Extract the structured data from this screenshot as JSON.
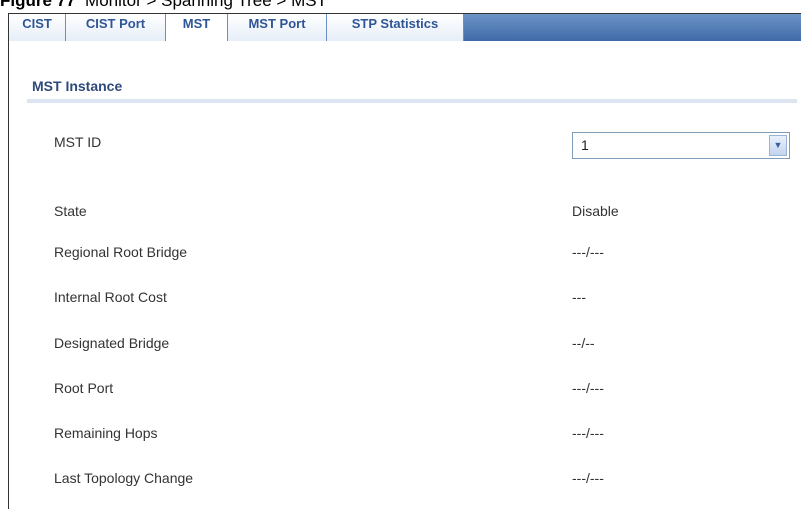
{
  "caption": {
    "figure": "Figure 77",
    "text": "Monitor > Spanning Tree > MST"
  },
  "tabs": [
    {
      "label": "CIST"
    },
    {
      "label": "CIST Port"
    },
    {
      "label": "MST"
    },
    {
      "label": "MST Port"
    },
    {
      "label": "STP Statistics"
    }
  ],
  "active_tab": "MST",
  "section": {
    "title": "MST Instance"
  },
  "mst_id": {
    "label": "MST ID",
    "value": "1"
  },
  "rows": [
    {
      "label": "State",
      "value": "Disable"
    },
    {
      "label": "Regional Root Bridge",
      "value": "---/---"
    },
    {
      "label": "Internal Root Cost",
      "value": "---"
    },
    {
      "label": "Designated Bridge",
      "value": "--/--"
    },
    {
      "label": "Root Port",
      "value": "---/---"
    },
    {
      "label": "Remaining Hops",
      "value": "---/---"
    },
    {
      "label": "Last Topology Change",
      "value": "---/---"
    }
  ],
  "colors": {
    "tabbar": "#3e6aa8",
    "tab_text": "#2f5597",
    "section_title": "#2f4a7a"
  }
}
